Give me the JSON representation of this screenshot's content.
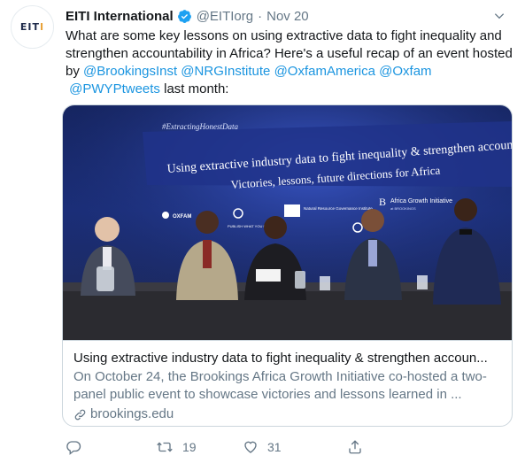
{
  "account": {
    "avatar_text": "EITI",
    "name": "EITI International",
    "handle": "@EITIorg",
    "separator": "·",
    "date": "Nov 20"
  },
  "tweet": {
    "text_1": "What are some key lessons on using extractive data to fight inequality and strengthen accountability in Africa? Here's a useful recap of an event hosted by ",
    "mentions": [
      "@BrookingsInst",
      "@NRGInstitute",
      "@OxfamAmerica",
      "@Oxfam",
      "@PWYPtweets"
    ],
    "text_2": " last month:"
  },
  "card": {
    "photo": {
      "hashtag": "#ExtractingHonestData",
      "banner_line_1": "Using extractive industry data to fight inequality & strengthen accounta",
      "banner_line_2": "Victories, lessons, future directions for Africa",
      "logo_oxfam": "OXFAM",
      "logo_pwyp": "PUBLISH WHAT YOU PAY",
      "logo_nrgi": "Natural Resource Governance Institute",
      "logo_agi": "Africa Growth Initiative",
      "logo_agi_sub": "at BROOKINGS",
      "logo_b": "B"
    },
    "title": "Using extractive industry data to fight inequality & strengthen accoun...",
    "description": "On October 24, the Brookings Africa Growth Initiative co-hosted a two-panel public event to showcase victories and lessons learned in ...",
    "domain": "brookings.edu"
  },
  "actions": {
    "reply_count": "",
    "retweet_count": "19",
    "like_count": "31"
  },
  "colors": {
    "link": "#1b95e0",
    "secondary_text": "#657786",
    "border": "#ccd6dd"
  }
}
